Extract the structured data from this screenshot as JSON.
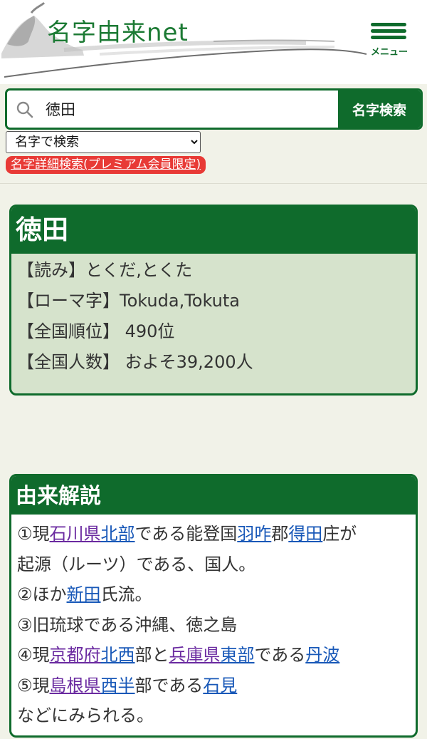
{
  "header": {
    "site_title": "名字由来net",
    "menu_label": "メニュー"
  },
  "search": {
    "value": "徳田",
    "button_label": "名字検索",
    "mode_selected": "名字で検索",
    "premium_link": "名字詳細検索(プレミアム会員限定)"
  },
  "summary": {
    "name": "徳田",
    "reading": "【読み】とくだ,とくた",
    "romaji": "【ローマ字】Tokuda,Tokuta",
    "rank": "【全国順位】 490位",
    "population": "【全国人数】 およそ39,200人"
  },
  "origin": {
    "heading": "由来解説",
    "lines": [
      [
        {
          "t": "①現"
        },
        {
          "t": "石川県",
          "link": true,
          "visited": true
        },
        {
          "t": "北部",
          "link": true
        },
        {
          "t": "である能登国"
        },
        {
          "t": "羽咋",
          "link": true
        },
        {
          "t": "郡"
        },
        {
          "t": "得田",
          "link": true
        },
        {
          "t": "庄が"
        }
      ],
      [
        {
          "t": "起源（ルーツ）である、国人。"
        }
      ],
      [
        {
          "t": "②ほか"
        },
        {
          "t": "新田",
          "link": true
        },
        {
          "t": "氏流。"
        }
      ],
      [
        {
          "t": "③旧琉球である沖縄、徳之島"
        }
      ],
      [
        {
          "t": "④現"
        },
        {
          "t": "京都府",
          "link": true,
          "visited": true
        },
        {
          "t": "北西",
          "link": true
        },
        {
          "t": "部と"
        },
        {
          "t": "兵庫県",
          "link": true,
          "visited": true
        },
        {
          "t": "東部",
          "link": true
        },
        {
          "t": "である"
        },
        {
          "t": "丹波",
          "link": true
        }
      ],
      [
        {
          "t": "⑤現"
        },
        {
          "t": "島根県",
          "link": true,
          "visited": true
        },
        {
          "t": "西半",
          "link": true
        },
        {
          "t": "部である"
        },
        {
          "t": "石見",
          "link": true
        }
      ],
      [
        {
          "t": "などにみられる。"
        }
      ]
    ]
  },
  "icons": {
    "search": "search-icon",
    "menu": "hamburger-menu-icon",
    "logo_art": "mountain-landscape-icon"
  },
  "colors": {
    "brand_green": "#0f6b2c",
    "summary_bg": "#d6e3cc",
    "page_bg": "#f1f2e8",
    "premium_red": "#e83a36",
    "link_blue": "#1858b8",
    "link_visited": "#6a2aa0"
  }
}
